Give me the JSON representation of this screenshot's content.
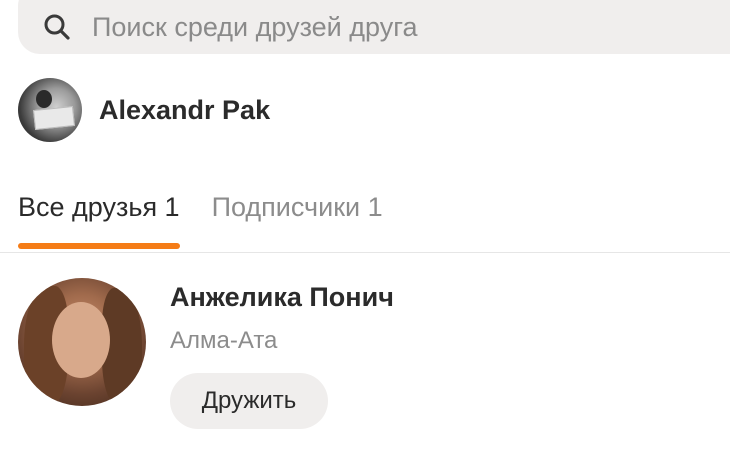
{
  "search": {
    "placeholder": "Поиск среди друзей друга"
  },
  "owner": {
    "name": "Alexandr Pak"
  },
  "tabs": [
    {
      "label": "Все друзья 1",
      "active": true
    },
    {
      "label": "Подписчики 1",
      "active": false
    }
  ],
  "friends": [
    {
      "name": "Анжелика Понич",
      "city": "Алма-Ата",
      "action_label": "Дружить"
    }
  ],
  "colors": {
    "accent": "#f57c16",
    "input_bg": "#f0eeed",
    "muted_text": "#8c8c8c"
  }
}
